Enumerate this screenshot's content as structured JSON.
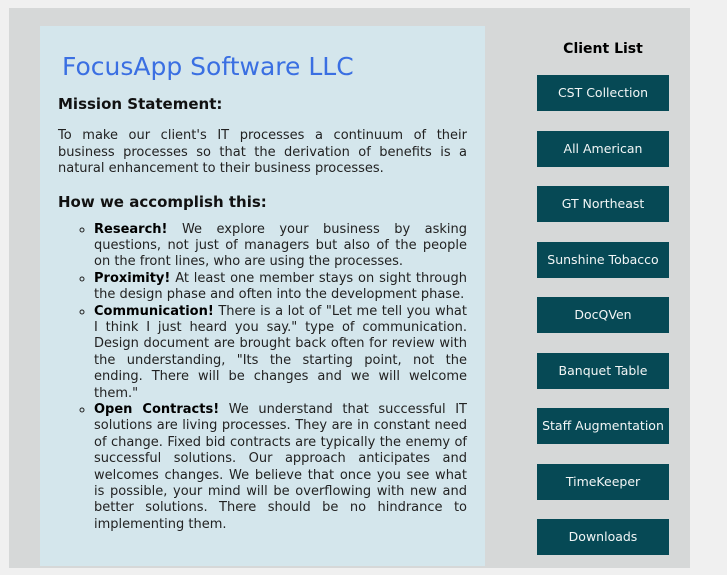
{
  "header": {
    "company_name": "FocusApp Software LLC"
  },
  "mission": {
    "title": "Mission Statement:",
    "text": "To make our client's IT processes a continuum of their business processes so that the derivation of benefits is a natural enhancement to their business processes."
  },
  "approach": {
    "title": "How we accomplish this:",
    "items": [
      {
        "term": "Research!",
        "text": " We explore your business by asking questions, not just of managers but also of the people on the front lines, who are using the processes."
      },
      {
        "term": "Proximity!",
        "text": " At least one member stays on sight through the design phase and often into the development phase."
      },
      {
        "term": "Communication!",
        "text": " There is a lot of \"Let me tell you what I think I just heard you say.\" type of communication. Design document are brought back often for review with the understanding, \"Its the starting point, not the ending. There will be changes and we will welcome them.\""
      },
      {
        "term": "Open Contracts!",
        "text": " We understand that successful IT solutions are living processes. They are in constant need of change. Fixed bid contracts are typically the enemy of successful solutions. Our approach anticipates and welcomes changes. We believe that once you see what is possible, your mind will be overflowing with new and better solutions. There should be no hindrance to implementing them."
      }
    ]
  },
  "sidebar": {
    "title": "Client List",
    "clients": [
      {
        "label": "CST Collection"
      },
      {
        "label": "All American"
      },
      {
        "label": "GT Northeast"
      },
      {
        "label": "Sunshine Tobacco"
      },
      {
        "label": "DocQVen"
      },
      {
        "label": "Banquet Table"
      },
      {
        "label": "Staff Augmentation"
      },
      {
        "label": "TimeKeeper"
      },
      {
        "label": "Downloads"
      }
    ]
  },
  "colors": {
    "company_blue": "#3a6fe2",
    "content_bg": "#d4e6ec",
    "button_bg": "#064955"
  }
}
